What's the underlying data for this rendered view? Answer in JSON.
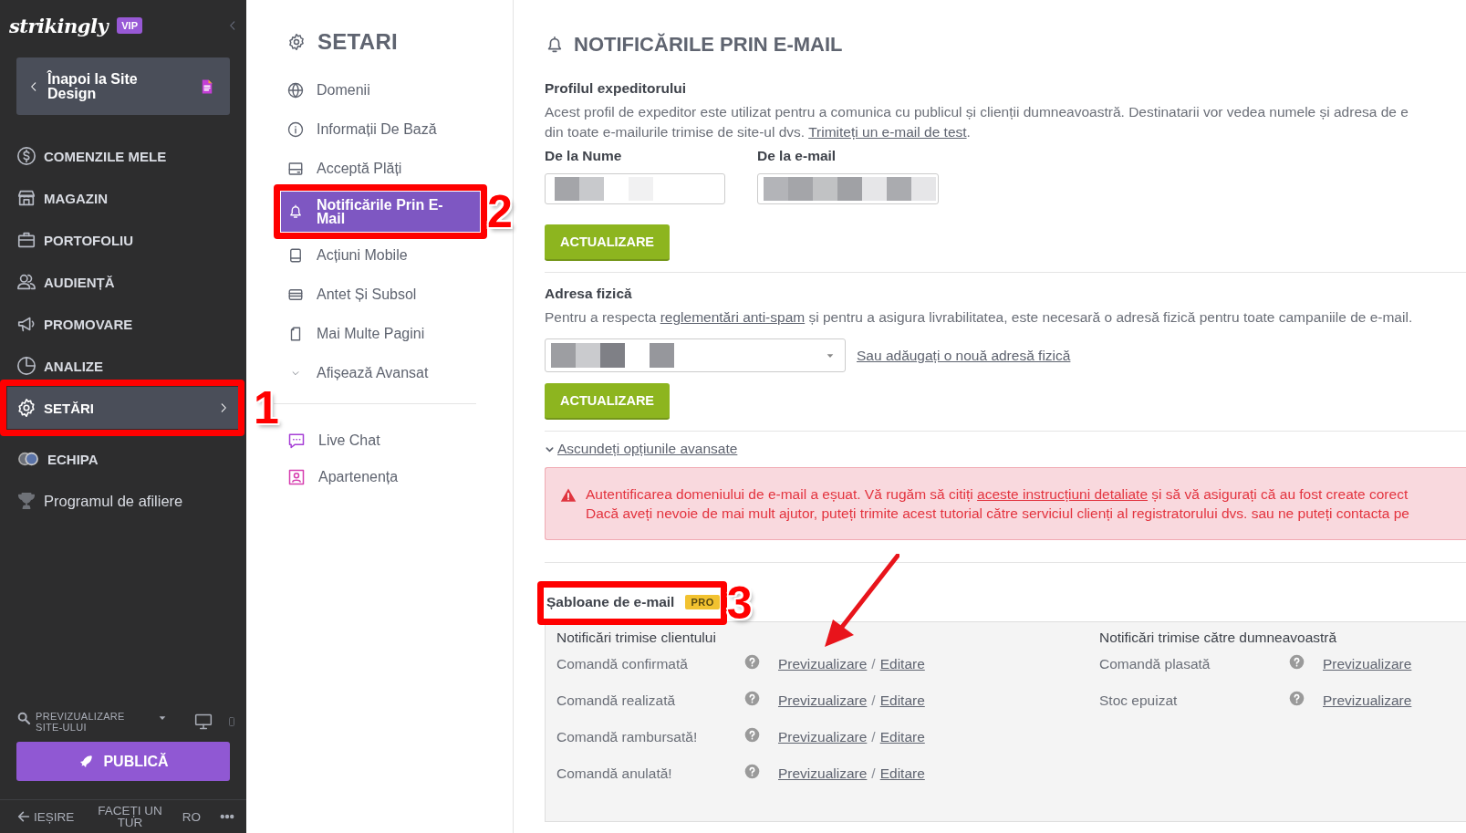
{
  "sidebar": {
    "logo": "strikingly",
    "badge": "VIP",
    "back_button": "Înapoi la Site Design",
    "items": [
      {
        "label": "COMENZILE MELE",
        "kind": "section",
        "selected": false
      },
      {
        "label": "MAGAZIN",
        "kind": "section",
        "selected": false
      },
      {
        "label": "PORTOFOLIU",
        "kind": "section",
        "selected": false
      },
      {
        "label": "AUDIENȚĂ",
        "kind": "section",
        "selected": false
      },
      {
        "label": "PROMOVARE",
        "kind": "section",
        "selected": false
      },
      {
        "label": "ANALIZE",
        "kind": "section",
        "selected": false
      },
      {
        "label": "SETĂRI",
        "kind": "section",
        "selected": true,
        "annotation": "1"
      },
      {
        "label": "ECHIPA",
        "kind": "section",
        "selected": false
      },
      {
        "label": "Programul de afiliere",
        "kind": "link",
        "selected": false
      }
    ],
    "preview": "PREVIZUALIZARE SITE-ULUI",
    "publish": "PUBLICĂ",
    "footer": {
      "exit": "IEȘIRE",
      "tour": "FACEȚI UN TUR",
      "language": "RO"
    }
  },
  "settings_nav": {
    "title": "SETARI",
    "items": [
      {
        "label": "Domenii",
        "selected": false
      },
      {
        "label": "Informații De Bază",
        "selected": false
      },
      {
        "label": "Acceptă Plăți",
        "selected": false
      },
      {
        "label": "Notificările Prin E-Mail",
        "selected": true,
        "annotation": "2"
      },
      {
        "label": "Acțiuni Mobile",
        "selected": false
      },
      {
        "label": "Antet Și Subsol",
        "selected": false
      },
      {
        "label": "Mai Multe Pagini",
        "selected": false
      },
      {
        "label": "Afișează Avansat",
        "selected": false
      }
    ],
    "extra_items": [
      {
        "label": "Live Chat"
      },
      {
        "label": "Apartenența"
      }
    ]
  },
  "main": {
    "title": "NOTIFICĂRILE PRIN E-MAIL",
    "sender_profile": {
      "heading": "Profilul expeditorului",
      "description_lines": [
        [
          {
            "text": "Acest profil de expeditor este utilizat pentru a comunica cu publicul și clienții dumneavoastră. Destinatarii vor vedea numele și adresa de e"
          }
        ],
        [
          {
            "text": "din toate e-mailurile trimise de site-ul dvs. "
          },
          {
            "link": "Trimiteți un e-mail de test"
          },
          {
            "text": "."
          }
        ]
      ],
      "fields": [
        {
          "label": "De la Nume",
          "redacted": true
        },
        {
          "label": "De la e-mail",
          "redacted": true
        }
      ],
      "button": "ACTUALIZARE"
    },
    "physical_address": {
      "heading": "Adresa fizică",
      "description_lines": [
        [
          {
            "text": "Pentru a respecta "
          },
          {
            "link": "reglementări anti-spam"
          },
          {
            "text": " și pentru a asigura livrabilitatea, este necesară o adresă fizică pentru toate campaniile de e-mail."
          }
        ]
      ],
      "select": {
        "redacted": true
      },
      "add_link": "Sau adăugați o nouă adresă fizică",
      "button": "ACTUALIZARE"
    },
    "advanced_toggle": {
      "label": "Ascundeți opțiunile avansate",
      "expanded": true
    },
    "alert": {
      "lines": [
        [
          {
            "text": "Autentificarea domeniului de e-mail a eșuat. Vă rugăm să citiți "
          },
          {
            "link": "aceste instrucțiuni detaliate"
          },
          {
            "text": " și să vă asigurați că au fost create corect"
          }
        ],
        [
          {
            "text": "Dacă aveți nevoie de mai mult ajutor, puteți trimite acest tutorial către serviciul clienți al registratorului dvs. sau ne puteți contacta pe"
          }
        ]
      ]
    },
    "templates": {
      "heading": "Șabloane de e-mail",
      "badge": "PRO",
      "annotation": "3",
      "arrow": true,
      "groups": [
        {
          "title": "Notificări trimise clientului",
          "rows": [
            {
              "name": "Comandă confirmată",
              "actions": [
                "Previzualizare",
                "Editare"
              ],
              "separator": "/"
            },
            {
              "name": "Comandă realizată",
              "actions": [
                "Previzualizare",
                "Editare"
              ],
              "separator": "/"
            },
            {
              "name": "Comandă rambursată!",
              "actions": [
                "Previzualizare",
                "Editare"
              ],
              "separator": "/"
            },
            {
              "name": "Comandă anulată!",
              "actions": [
                "Previzualizare",
                "Editare"
              ],
              "separator": "/"
            }
          ]
        },
        {
          "title": "Notificări trimise către dumneavoastră",
          "rows": [
            {
              "name": "Comandă plasată",
              "actions": [
                "Previzualizare"
              ]
            },
            {
              "name": "Stoc epuizat",
              "actions": [
                "Previzualizare"
              ]
            }
          ]
        }
      ]
    }
  }
}
